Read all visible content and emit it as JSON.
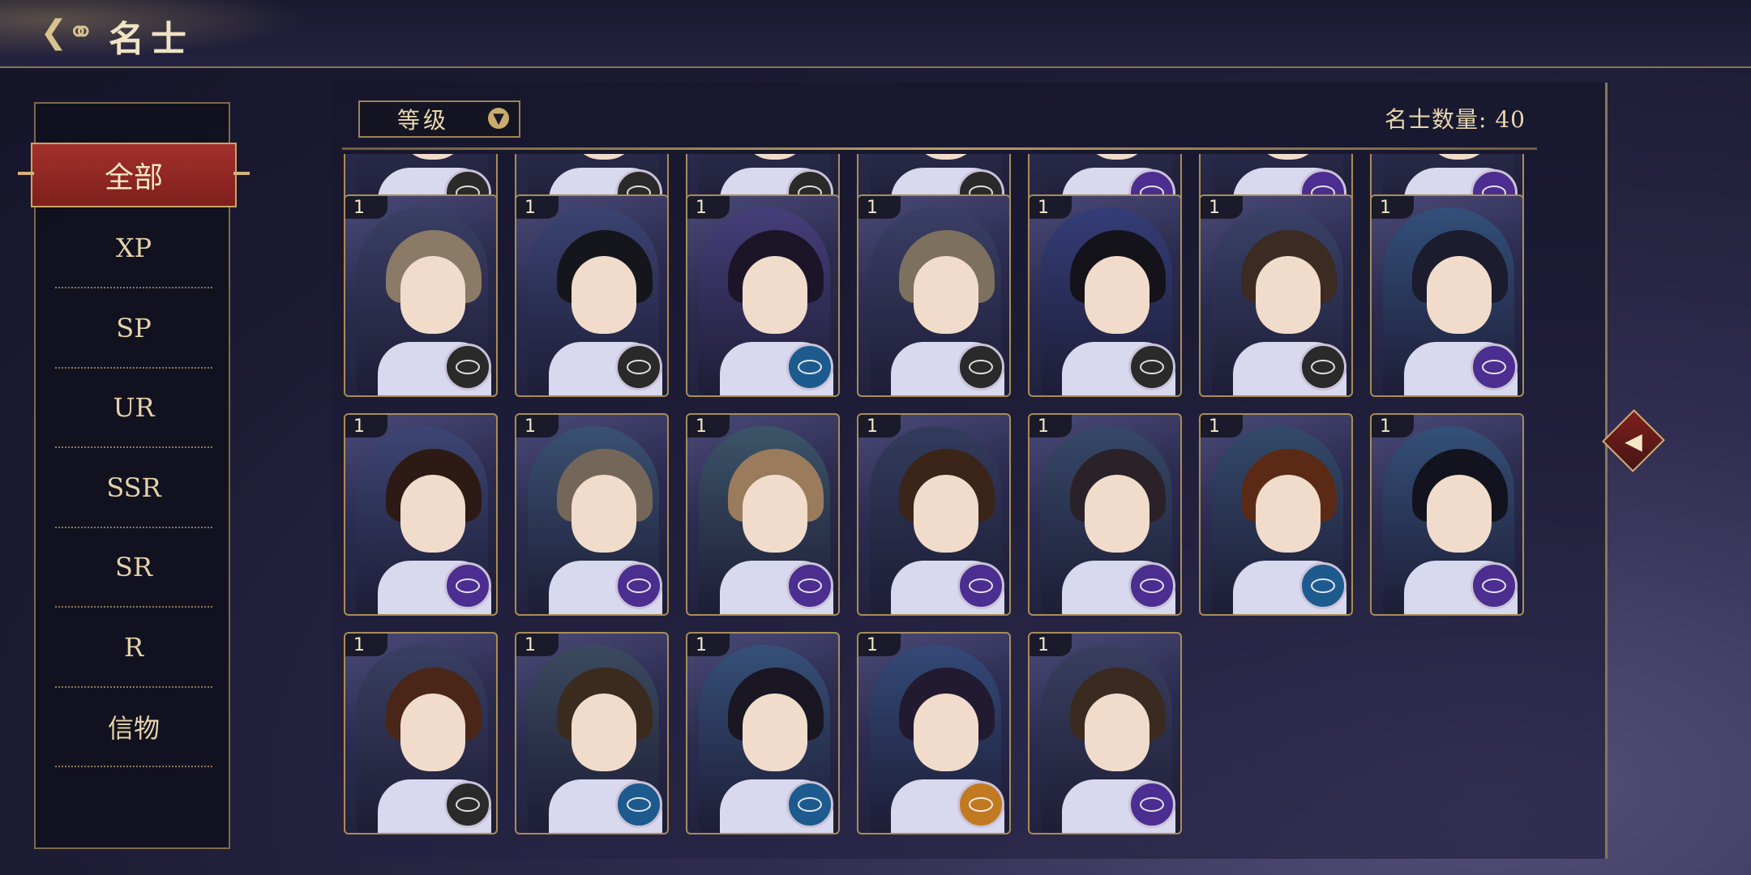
{
  "header": {
    "title": "名士",
    "back_icon": "cloud-back-icon"
  },
  "categories": [
    {
      "label": "全部",
      "active": true
    },
    {
      "label": "XP",
      "active": false
    },
    {
      "label": "SP",
      "active": false
    },
    {
      "label": "UR",
      "active": false
    },
    {
      "label": "SSR",
      "active": false
    },
    {
      "label": "SR",
      "active": false
    },
    {
      "label": "R",
      "active": false
    },
    {
      "label": "信物",
      "active": false
    }
  ],
  "sort": {
    "label": "等级",
    "icon": "chevron-down-icon"
  },
  "count": {
    "label": "名士数量: 40"
  },
  "colors": {
    "element_gold": "#2a2a2a",
    "element_blue": "#1d5a8e",
    "element_purple": "#4b2e8f",
    "element_orange": "#c27a22",
    "active_category": "#8f2622"
  },
  "cards": [
    {
      "row": 0,
      "level": "",
      "element": "gold"
    },
    {
      "row": 0,
      "level": "",
      "element": "gold"
    },
    {
      "row": 0,
      "level": "",
      "element": "gold"
    },
    {
      "row": 0,
      "level": "",
      "element": "gold"
    },
    {
      "row": 0,
      "level": "",
      "element": "purple"
    },
    {
      "row": 0,
      "level": "",
      "element": "purple"
    },
    {
      "row": 0,
      "level": "",
      "element": "purple"
    },
    {
      "row": 1,
      "level": "1",
      "element": "gold",
      "hair": "#8b7a66",
      "bg": "#3a3f64"
    },
    {
      "row": 1,
      "level": "1",
      "element": "gold",
      "hair": "#15151c",
      "bg": "#3b4372"
    },
    {
      "row": 1,
      "level": "1",
      "element": "blue",
      "hair": "#1c1528",
      "bg": "#473e7a"
    },
    {
      "row": 1,
      "level": "1",
      "element": "gold",
      "hair": "#7d705e",
      "bg": "#3b3f66"
    },
    {
      "row": 1,
      "level": "1",
      "element": "gold",
      "hair": "#15131a",
      "bg": "#343d78"
    },
    {
      "row": 1,
      "level": "1",
      "element": "gold",
      "hair": "#3b2b22",
      "bg": "#3b4268"
    },
    {
      "row": 1,
      "level": "1",
      "element": "purple",
      "hair": "#1b1c2e",
      "bg": "#33507a"
    },
    {
      "row": 2,
      "level": "1",
      "element": "purple",
      "hair": "#2e1a14",
      "bg": "#3d4573"
    },
    {
      "row": 2,
      "level": "1",
      "element": "purple",
      "hair": "#75665a",
      "bg": "#3a5172"
    },
    {
      "row": 2,
      "level": "1",
      "element": "purple",
      "hair": "#9a7c5c",
      "bg": "#3c5468"
    },
    {
      "row": 2,
      "level": "1",
      "element": "purple",
      "hair": "#3b2418",
      "bg": "#333b5c"
    },
    {
      "row": 2,
      "level": "1",
      "element": "purple",
      "hair": "#2a2228",
      "bg": "#374868"
    },
    {
      "row": 2,
      "level": "1",
      "element": "blue",
      "hair": "#5b2a16",
      "bg": "#334a6a"
    },
    {
      "row": 2,
      "level": "1",
      "element": "purple",
      "hair": "#12131e",
      "bg": "#355078"
    },
    {
      "row": 3,
      "level": "1",
      "element": "gold",
      "hair": "#4a2618",
      "bg": "#3a3f62"
    },
    {
      "row": 3,
      "level": "1",
      "element": "blue",
      "hair": "#3b2a1e",
      "bg": "#3b4a5e"
    },
    {
      "row": 3,
      "level": "1",
      "element": "blue",
      "hair": "#1a1622",
      "bg": "#365078"
    },
    {
      "row": 3,
      "level": "1",
      "element": "orange",
      "hair": "#221a30",
      "bg": "#344a78"
    },
    {
      "row": 3,
      "level": "1",
      "element": "purple",
      "hair": "#3b2a20",
      "bg": "#3a3f60"
    }
  ]
}
